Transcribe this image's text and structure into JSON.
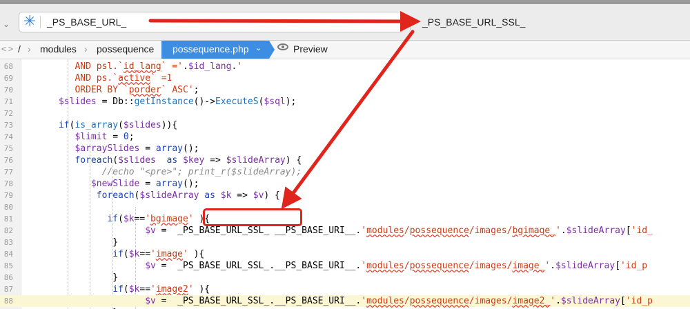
{
  "find_bar": {
    "search_value": "_PS_BASE_URL_",
    "replace_value": "_PS_BASE_URL_SSL_",
    "search_icon": "asterisk-search-icon"
  },
  "breadcrumb": {
    "items": [
      "/",
      "modules",
      "possequence"
    ],
    "active_file": "possequence.php",
    "preview_label": "Preview"
  },
  "code": {
    "highlighted_line": 88,
    "lines": [
      {
        "n": "68",
        "html": "         <span class='s'>AND psl.`<span class='sq'>id_lang</span>` ='</span>.<span class='v'>$id_lang</span>.<span class='s'>'</span>"
      },
      {
        "n": "69",
        "html": "         <span class='s'>AND ps.`<span class='sq'>active</span>` =1</span>"
      },
      {
        "n": "70",
        "html": "         <span class='s'>ORDER BY `<span class='sq'>porder</span>` ASC'</span>;"
      },
      {
        "n": "71",
        "html": "      <span class='v'>$slides</span> = Db::<span class='f'>getInstance</span>()-&gt;<span class='f'>ExecuteS</span>(<span class='v'>$sql</span>);"
      },
      {
        "n": "72",
        "html": ""
      },
      {
        "n": "73",
        "html": "      <span class='k'>if</span>(<span class='f'>is_array</span>(<span class='v'>$slides</span>)){"
      },
      {
        "n": "74",
        "html": "         <span class='v'>$limit</span> = <span class='k'>0</span>;"
      },
      {
        "n": "75",
        "html": "         <span class='v'>$arraySlides</span> = <span class='k'>array</span>();"
      },
      {
        "n": "76",
        "html": "         <span class='k'>foreach</span>(<span class='v'>$slides</span>  <span class='k'>as</span> <span class='v'>$key</span> =&gt; <span class='v'>$slideArray</span>) {"
      },
      {
        "n": "77",
        "html": "              <span class='c'>//echo \"&lt;pre&gt;\"; print_r($slideArray);</span>"
      },
      {
        "n": "78",
        "html": "            <span class='v'>$newSlide</span> = <span class='k'>array</span>();"
      },
      {
        "n": "79",
        "html": "             <span class='k'>foreach</span>(<span class='v'>$slideArray</span> <span class='k'>as</span> <span class='v'>$k</span> =&gt; <span class='v'>$v</span>) {"
      },
      {
        "n": "80",
        "html": ""
      },
      {
        "n": "81",
        "html": "               <span class='k'>if</span>(<span class='v'>$k</span>==<span class='s'>'<span class='sq'>bgimage</span>'</span> ){"
      },
      {
        "n": "82",
        "html": "                      <span class='v'>$v</span> =  _PS_BASE_URL_SSL_ __PS_BASE_URI__.<span class='s'>'<span class='sq'>modules</span>/<span class='sq'>possequence</span>/images/<span class='sq'>bgimage_</span>'</span>.<span class='v'>$slideArray</span>[<span class='s'>'id_</span>"
      },
      {
        "n": "83",
        "html": "                }"
      },
      {
        "n": "84",
        "html": "                <span class='k'>if</span>(<span class='v'>$k</span>==<span class='s'>'<span class='sq'>image</span>'</span> ){"
      },
      {
        "n": "85",
        "html": "                      <span class='v'>$v</span> =  _PS_BASE_URL_SSL_.__PS_BASE_URI__.<span class='s'>'<span class='sq'>modules</span>/<span class='sq'>possequence</span>/images/<span class='sq'>image_</span>'</span>.<span class='v'>$slideArray</span>[<span class='s'>'id_p</span>"
      },
      {
        "n": "86",
        "html": "                }"
      },
      {
        "n": "87",
        "html": "                <span class='k'>if</span>(<span class='v'>$k</span>==<span class='s'>'<span class='sq'>image2</span>'</span> ){"
      },
      {
        "n": "88",
        "html": "                      <span class='v'>$v</span> =  _PS_BASE_URL_SSL_.__PS_BASE_URI__.<span class='s'>'<span class='sq'>modules</span>/<span class='sq'>possequence</span>/images/<span class='sq'>image2_</span>'</span>.<span class='v'>$slideArray</span>[<span class='s'>'id_p</span>"
      },
      {
        "n": "89",
        "html": "                }"
      }
    ]
  },
  "colors": {
    "accent": "#3d8ee3",
    "annotation_red": "#e0261c"
  }
}
